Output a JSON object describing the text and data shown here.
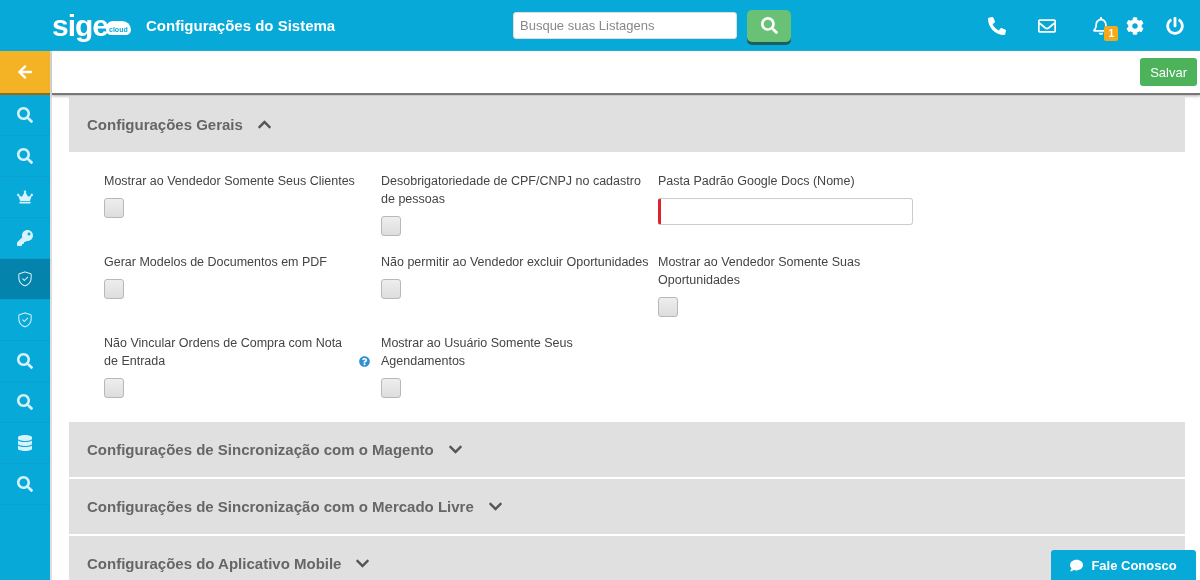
{
  "header": {
    "logo": "sige",
    "logo_badge": "cloud",
    "title": "Configurações do Sistema",
    "search": {
      "placeholder": "Busque suas Listagens"
    },
    "notification_count": "1"
  },
  "sidebar": {
    "items": [
      {
        "kind": "search",
        "selected": false
      },
      {
        "kind": "search",
        "selected": false
      },
      {
        "kind": "crown",
        "selected": false
      },
      {
        "kind": "key",
        "selected": false
      },
      {
        "kind": "shield",
        "selected": true
      },
      {
        "kind": "shield",
        "selected": false
      },
      {
        "kind": "search",
        "selected": false
      },
      {
        "kind": "search",
        "selected": false
      },
      {
        "kind": "database",
        "selected": false
      },
      {
        "kind": "search",
        "selected": false
      }
    ]
  },
  "toolbar": {
    "save_button": "Salvar"
  },
  "sections": [
    {
      "title": "Configurações Gerais",
      "expanded": true,
      "fields": [
        {
          "kind": "checkbox",
          "label": "Mostrar ao Vendedor Somente Seus Clientes",
          "checked": false
        },
        {
          "kind": "checkbox",
          "label": "Desobrigatoriedade de CPF/CNPJ no cadastro de pessoas",
          "checked": false
        },
        {
          "kind": "text",
          "label": "Pasta Padrão Google Docs (Nome)",
          "required": true
        },
        {
          "kind": "checkbox",
          "label": "Gerar Modelos de Documentos em PDF",
          "checked": false
        },
        {
          "kind": "checkbox",
          "label": "Não permitir ao Vendedor excluir Oportunidades",
          "checked": false
        },
        {
          "kind": "checkbox",
          "label": "Mostrar ao Vendedor Somente Suas Oportunidades",
          "checked": false
        },
        {
          "kind": "checkbox",
          "label": "Não Vincular Ordens de Compra com Nota de Entrada",
          "checked": false,
          "help": true
        },
        {
          "kind": "checkbox",
          "label": "Mostrar ao Usuário Somente Seus Agendamentos",
          "checked": false
        }
      ]
    },
    {
      "title": "Configurações de Sincronização com o Magento",
      "expanded": false
    },
    {
      "title": "Configurações de Sincronização com o Mercado Livre",
      "expanded": false
    },
    {
      "title": "Configurações do Aplicativo Mobile",
      "expanded": false
    }
  ],
  "chat_button": "Fale Conosco"
}
